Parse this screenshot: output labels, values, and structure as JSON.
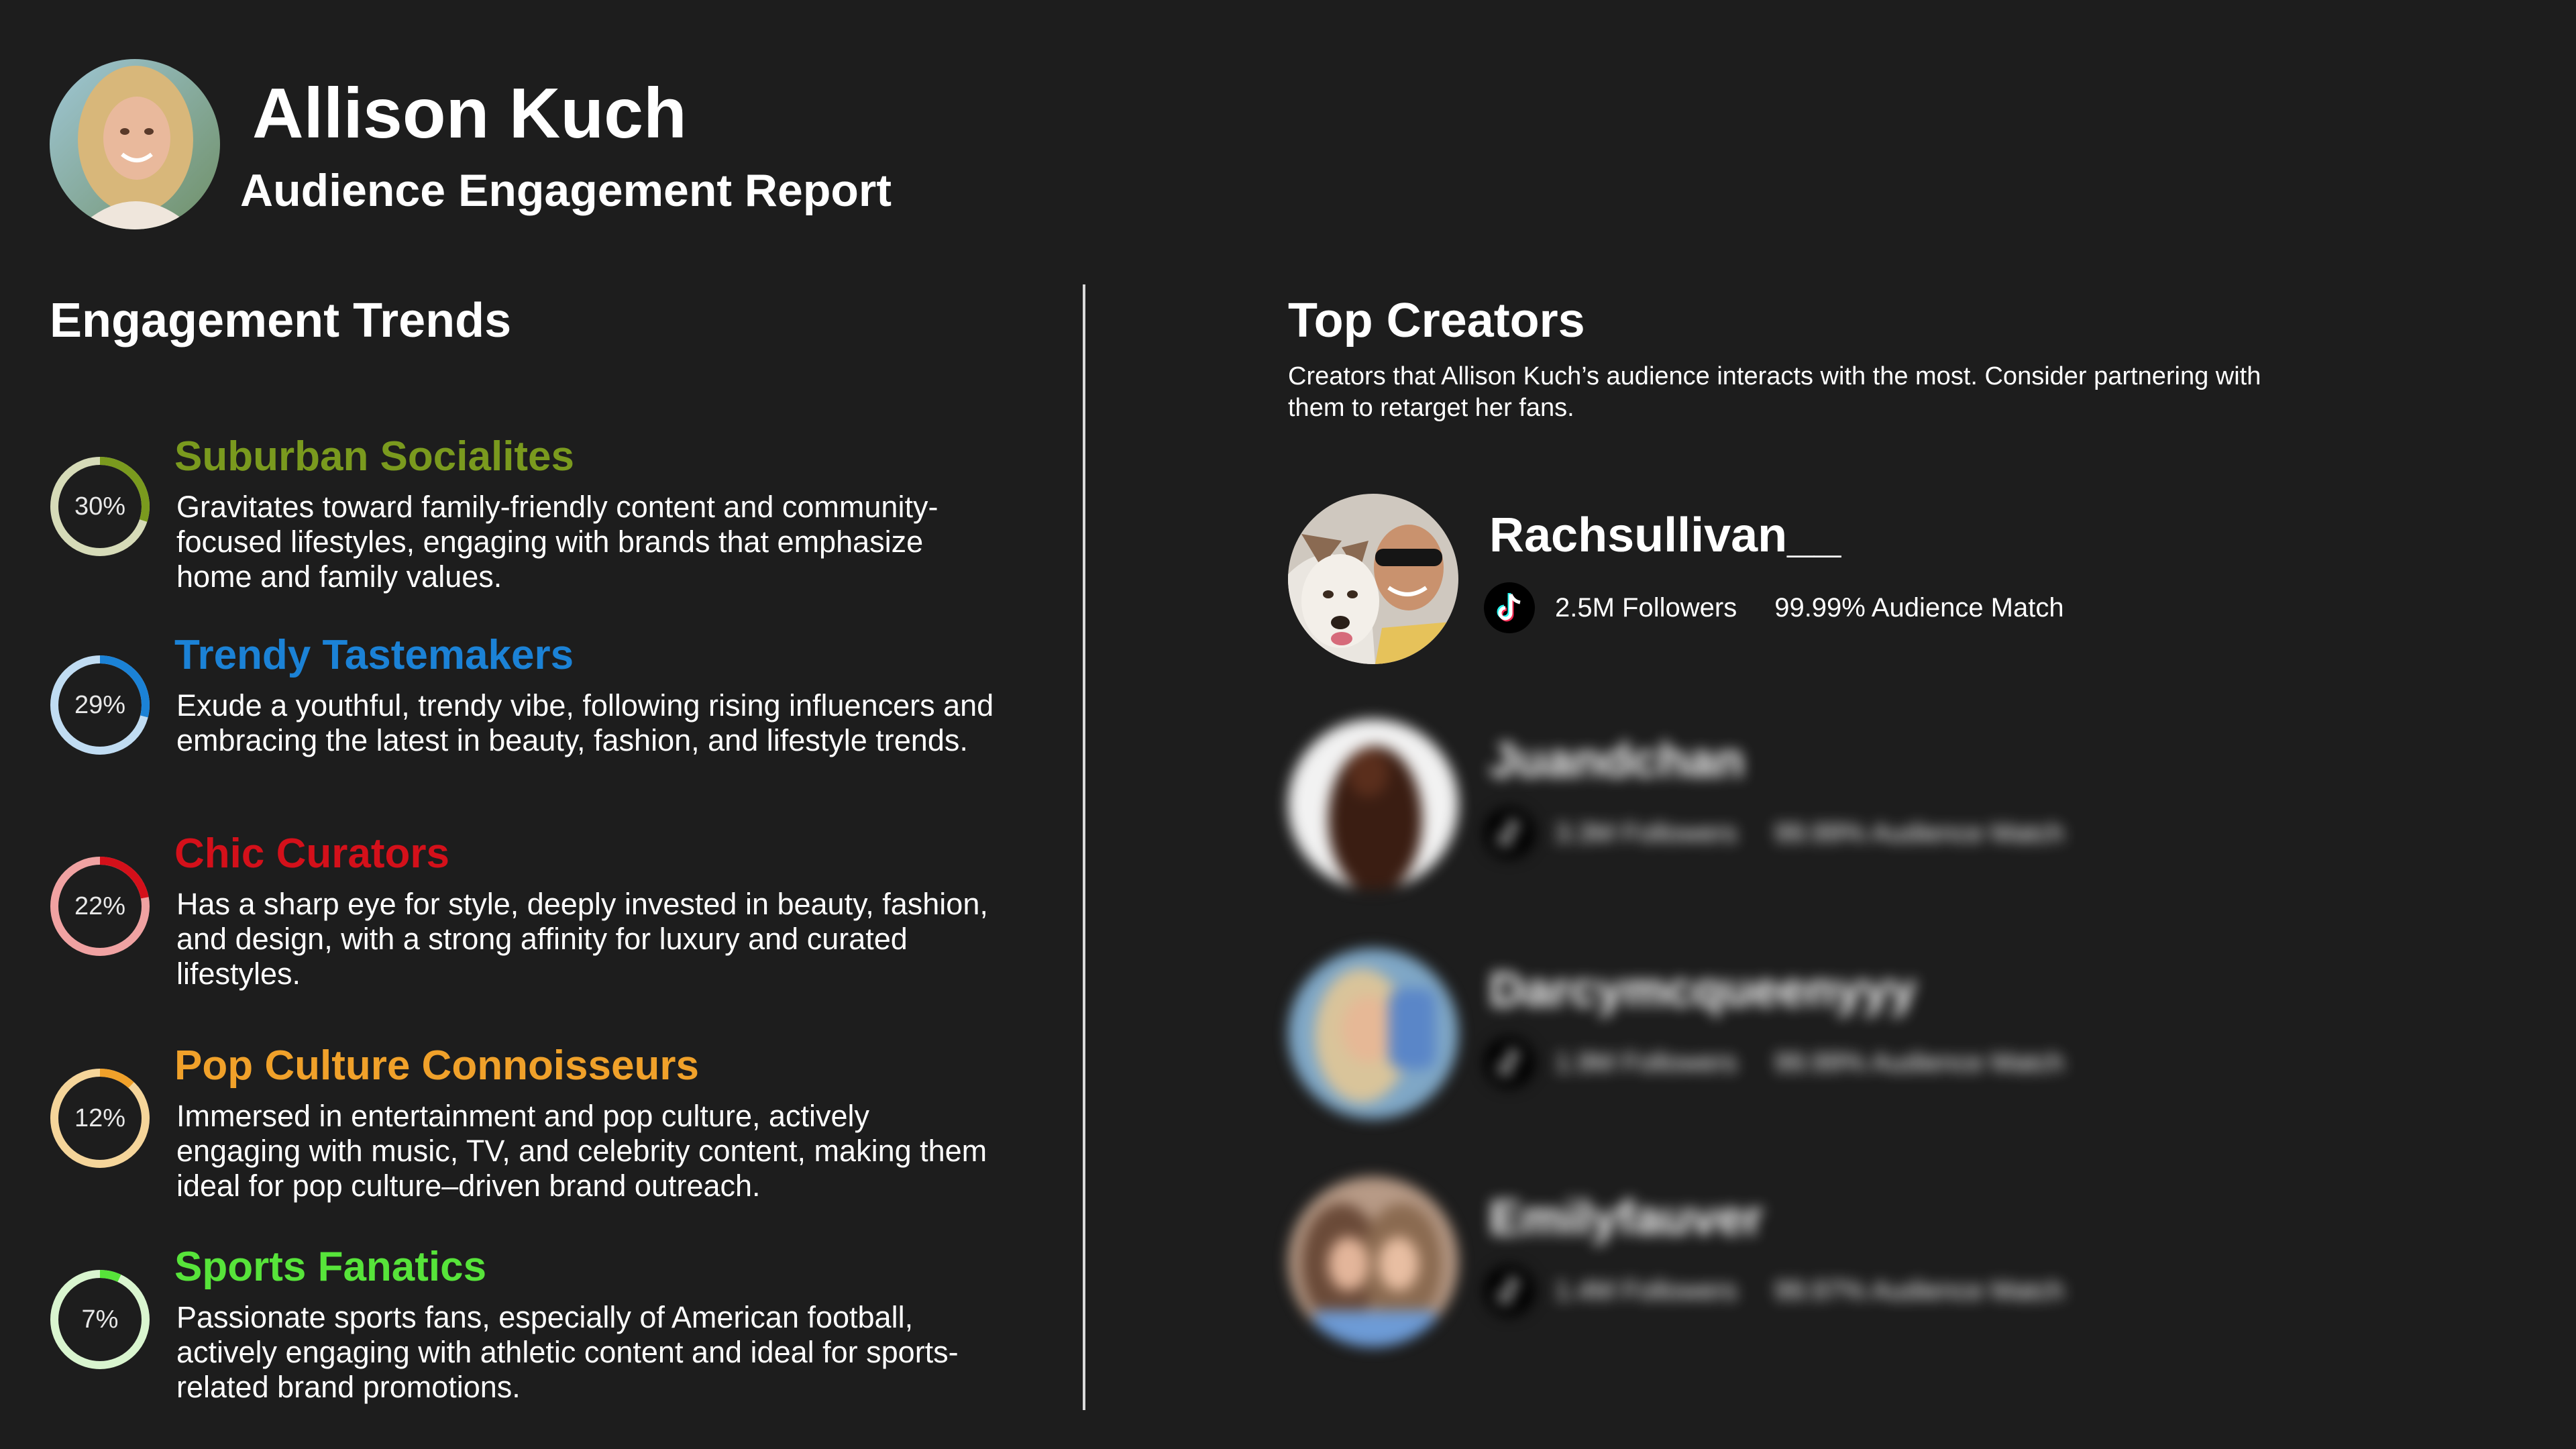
{
  "header": {
    "name": "Allison Kuch",
    "subtitle": "Audience Engagement Report",
    "avatar_icon": "profile-photo"
  },
  "engagement": {
    "title": "Engagement Trends",
    "trends": [
      {
        "name": "Suburban Socialites",
        "percent_label": "30%",
        "percent": 30,
        "color": "#7a9a1e",
        "track_color": "#d6dbb8",
        "description": "Gravitates toward family-friendly content and community-focused lifestyles, engaging with brands that emphasize home and family values."
      },
      {
        "name": "Trendy Tastemakers",
        "percent_label": "29%",
        "percent": 29,
        "color": "#1b82d6",
        "track_color": "#c0dcf2",
        "description": "Exude a youthful, trendy vibe, following rising influencers and embracing the latest in beauty, fashion, and lifestyle trends."
      },
      {
        "name": "Chic Curators",
        "percent_label": "22%",
        "percent": 22,
        "color": "#d4101a",
        "track_color": "#f0a2a2",
        "description": "Has a sharp eye for style, deeply invested in beauty, fashion, and design, with a strong affinity for luxury and curated lifestyles."
      },
      {
        "name": "Pop Culture Connoisseurs",
        "percent_label": "12%",
        "percent": 12,
        "color": "#f0a12a",
        "track_color": "#f5d59a",
        "description": "Immersed in entertainment and pop culture, actively engaging with music, TV, and celebrity content, making them ideal for pop culture–driven brand outreach."
      },
      {
        "name": "Sports Fanatics",
        "percent_label": "7%",
        "percent": 7,
        "color": "#57e43a",
        "track_color": "#d9f5cf",
        "description": "Passionate sports fans, especially of American football, actively engaging with athletic content and ideal for sports-related brand promotions."
      }
    ]
  },
  "creators": {
    "title": "Top Creators",
    "description": "Creators that Allison Kuch’s audience interacts with the most. Consider partnering with them to retarget her fans.",
    "platform_icon": "tiktok-icon",
    "list": [
      {
        "name": "Rachsullivan__",
        "followers": "2.5M Followers",
        "match": "99.99% Audience Match",
        "blurred": false
      },
      {
        "name": "Juandchan",
        "followers": "3.3M Followers",
        "match": "99.99% Audience Match",
        "blurred": true
      },
      {
        "name": "Darcymcqueenyyy",
        "followers": "1.9M Followers",
        "match": "99.99% Audience Match",
        "blurred": true
      },
      {
        "name": "Emilyfauver",
        "followers": "1.4M Followers",
        "match": "99.97% Audience Match",
        "blurred": true
      }
    ]
  }
}
